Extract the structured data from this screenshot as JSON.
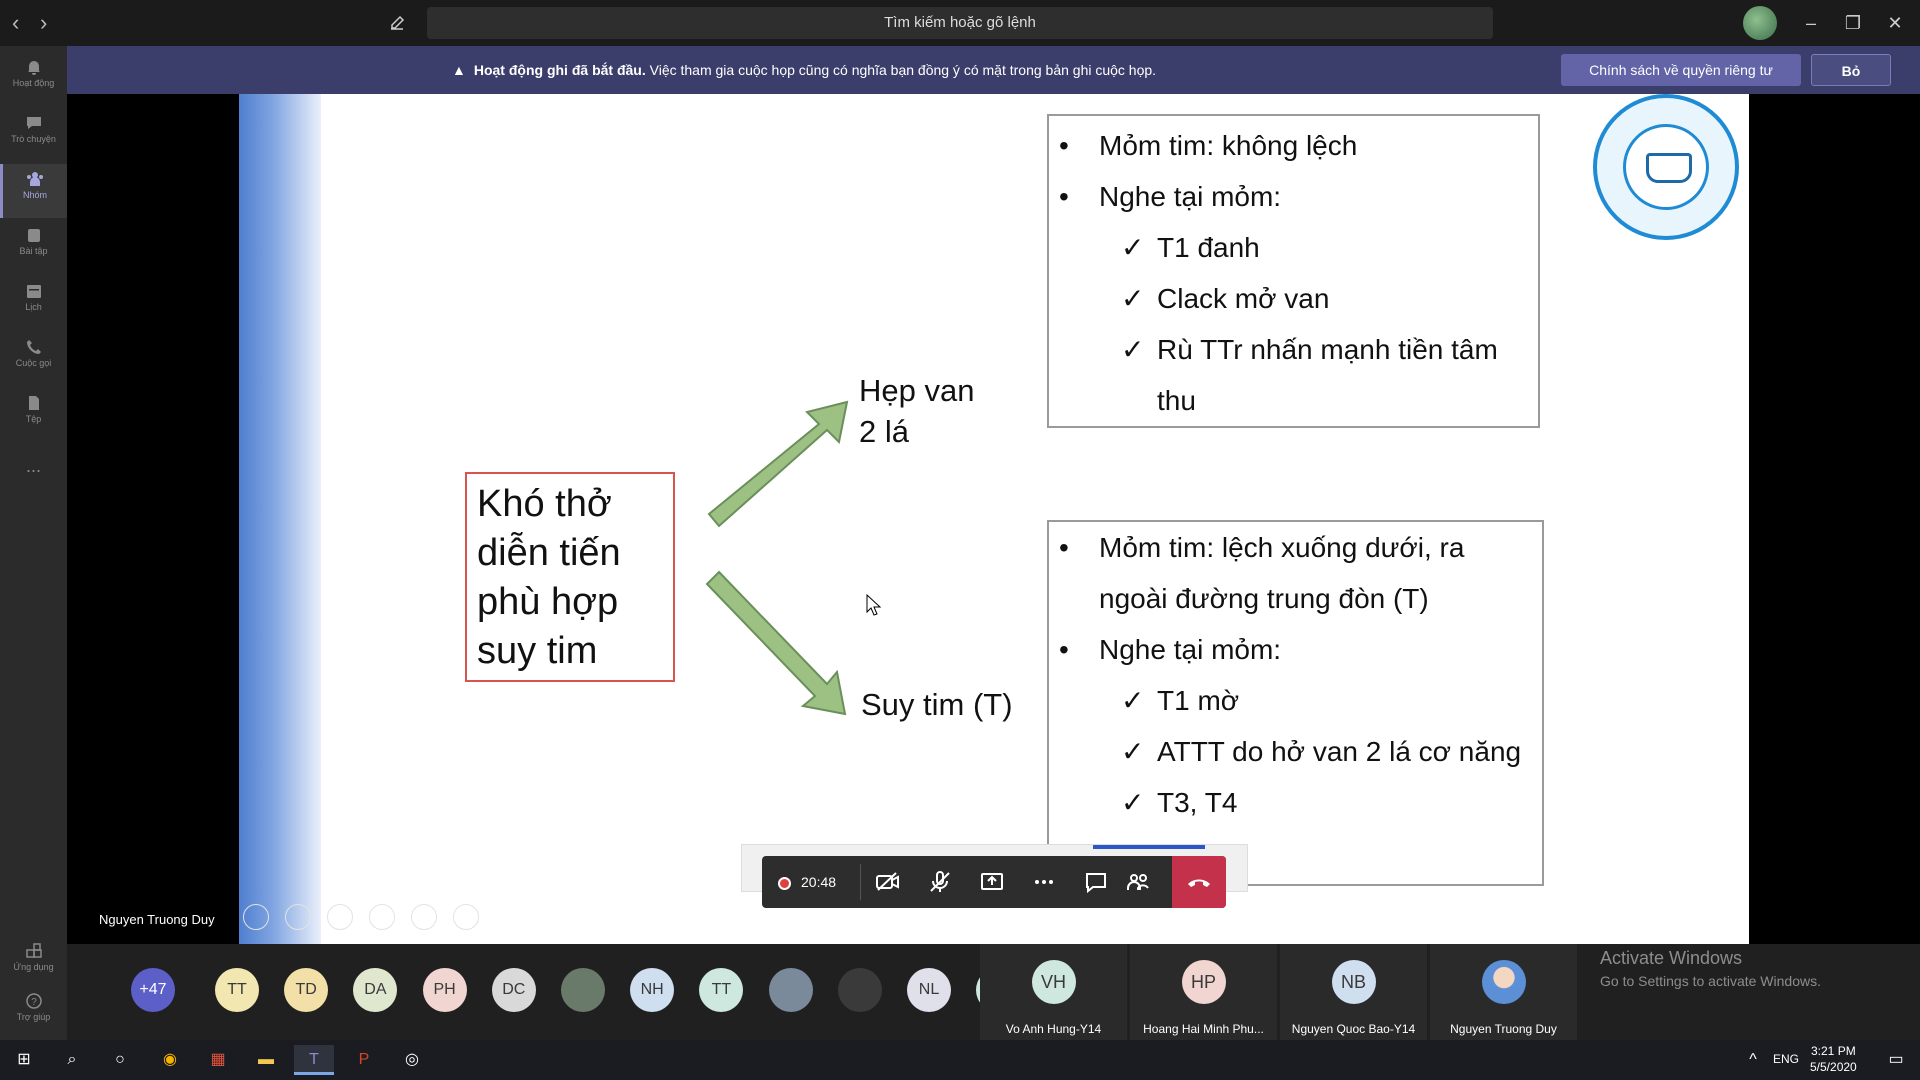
{
  "titlebar": {
    "search_placeholder": "Tìm kiếm hoặc gõ lệnh",
    "back_icon": "chevron-left-icon",
    "forward_icon": "chevron-right-icon"
  },
  "rail": {
    "items": [
      {
        "label": "Hoạt động",
        "icon": "bell-icon"
      },
      {
        "label": "Trò chuyện",
        "icon": "chat-icon"
      },
      {
        "label": "Nhóm",
        "icon": "teams-icon"
      },
      {
        "label": "Bài tập",
        "icon": "assignments-icon"
      },
      {
        "label": "Lịch",
        "icon": "calendar-icon"
      },
      {
        "label": "Cuộc gọi",
        "icon": "phone-icon"
      },
      {
        "label": "Tệp",
        "icon": "file-icon"
      }
    ],
    "more": "...",
    "apps_label": "Ứng dụng",
    "help_label": "Trợ giúp"
  },
  "banner": {
    "bold": "Hoạt động ghi đã bắt đầu.",
    "text": " Việc tham gia cuộc họp cũng có nghĩa bạn đồng ý có mặt trong bản ghi cuộc họp.",
    "privacy_button": "Chính sách về quyền riêng tư",
    "dismiss_button": "Bỏ"
  },
  "slide": {
    "main_box": "Khó thở diễn tiến phù hợp suy tim",
    "label_top": "Hẹp van 2 lá",
    "label_bottom": "Suy tim (T)",
    "top_box": [
      {
        "type": "bullet",
        "text": "Mỏm tim: không lệch"
      },
      {
        "type": "bullet",
        "text": "Nghe tại mỏm:"
      },
      {
        "type": "check",
        "text": "T1 đanh"
      },
      {
        "type": "check",
        "text": "Clack mở van"
      },
      {
        "type": "check",
        "text": "Rù TTr nhấn mạnh tiền tâm"
      },
      {
        "type": "cont",
        "text": "thu"
      }
    ],
    "bottom_box": [
      {
        "type": "bullet",
        "text": "Mỏm tim: lệch xuống dưới, ra"
      },
      {
        "type": "cont2",
        "text": "ngoài đường trung đòn (T)"
      },
      {
        "type": "bullet",
        "text": "Nghe tại mỏm:"
      },
      {
        "type": "check",
        "text": "T1 mờ"
      },
      {
        "type": "check",
        "text": "ATTT do hở van 2 lá cơ năng"
      },
      {
        "type": "check",
        "text": "T3, T4"
      }
    ],
    "presenter": "Nguyen Truong Duy"
  },
  "call": {
    "timer": "20:48",
    "accent": "#c4314b"
  },
  "participants": {
    "overflow": "+47",
    "avatars": [
      {
        "initials": "TT",
        "color": "#f3e7b1"
      },
      {
        "initials": "TD",
        "color": "#f3e0a8"
      },
      {
        "initials": "DA",
        "color": "#dfe8cf"
      },
      {
        "initials": "PH",
        "color": "#f1d5d0"
      },
      {
        "initials": "DC",
        "color": "#d9d9d9"
      },
      {
        "initials": "",
        "color": "#6a7a6a"
      },
      {
        "initials": "NH",
        "color": "#cfdff0"
      },
      {
        "initials": "TT",
        "color": "#cfe8df"
      },
      {
        "initials": "",
        "color": "#7a8a9a"
      },
      {
        "initials": "",
        "color": "#3a3a3a"
      },
      {
        "initials": "NL",
        "color": "#e0e0ea"
      },
      {
        "initials": "TT",
        "color": "#cfe8df"
      }
    ],
    "tiles": [
      {
        "initials": "VH",
        "name": "Vo Anh Hung-Y14",
        "color": "#cfe8df"
      },
      {
        "initials": "HP",
        "name": "Hoang Hai Minh Phu...",
        "color": "#f1d5d0"
      },
      {
        "initials": "NB",
        "name": "Nguyen Quoc Bao-Y14",
        "color": "#cfdff0"
      },
      {
        "initials": "",
        "name": "Nguyen Truong Duy",
        "color": "#5b8fd6"
      }
    ]
  },
  "watermark": {
    "title": "Activate Windows",
    "subtitle": "Go to Settings to activate Windows."
  },
  "taskbar": {
    "lang": "ENG",
    "time": "3:21 PM",
    "date": "5/5/2020"
  }
}
